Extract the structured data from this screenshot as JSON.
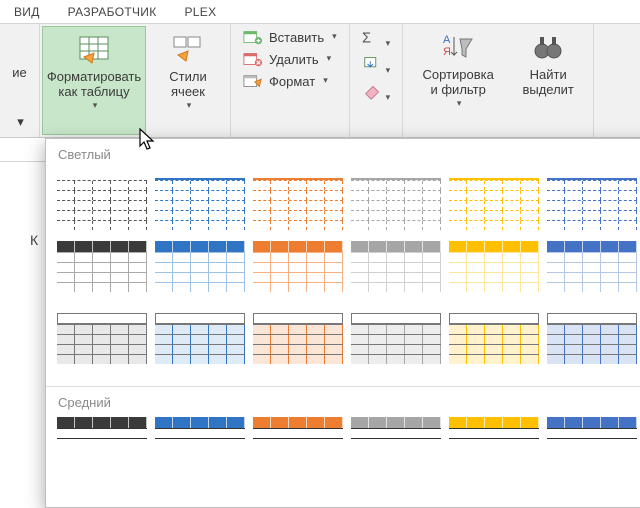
{
  "tabs": {
    "vid": "ВИД",
    "dev": "РАЗРАБОТЧИК",
    "plex": "PLEX"
  },
  "ribbon": {
    "trail_left": "ие",
    "format_as_table": "Форматировать\nкак таблицу",
    "cell_styles": "Стили\nячеек",
    "insert": "Вставить",
    "delete": "Удалить",
    "format": "Формат",
    "sort_filter": "Сортировка\nи фильтр",
    "find_select": "Найти\nвыделит"
  },
  "gallery": {
    "light": "Светлый",
    "medium": "Средний"
  },
  "colors": {
    "black": "#444444",
    "blue": "#2f75c4",
    "orange": "#ed7d31",
    "gray": "#a6a6a6",
    "yellow": "#ffc000",
    "blue2": "#4472c4",
    "headBlack": "#3a3a3a"
  },
  "worksheet": {
    "rowK": "К"
  }
}
